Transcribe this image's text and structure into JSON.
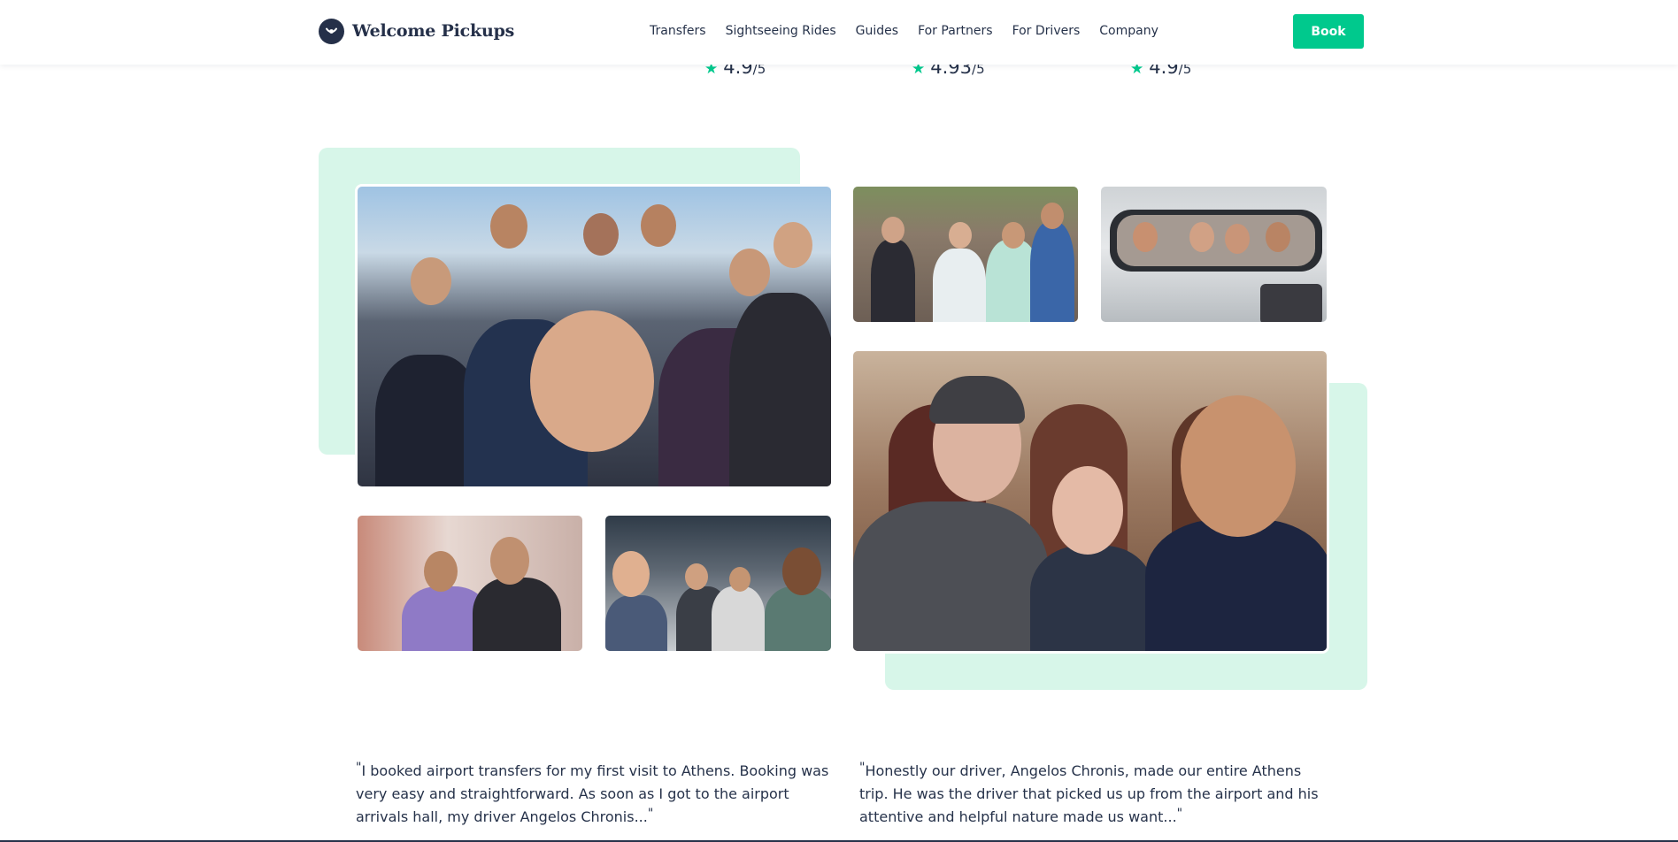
{
  "brand": {
    "name": "Welcome Pickups",
    "logo_icon": "welcome-pickups-logo-icon",
    "accent_color": "#00c98d",
    "dark_color": "#253049",
    "decor_color": "#d7f6e9"
  },
  "nav": {
    "items": [
      {
        "label": "Transfers"
      },
      {
        "label": "Sightseeing Rides"
      },
      {
        "label": "Guides"
      },
      {
        "label": "For Partners"
      },
      {
        "label": "For Drivers"
      },
      {
        "label": "Company"
      }
    ],
    "book_label": "Book"
  },
  "ratings": [
    {
      "value": "4.9",
      "suffix": "/5",
      "icon": "star-icon"
    },
    {
      "value": "4.93",
      "suffix": "/5",
      "icon": "star-icon"
    },
    {
      "value": "4.9",
      "suffix": "/5",
      "icon": "star-icon"
    }
  ],
  "testimonials": [
    {
      "open_mark": "\"",
      "text": "I booked airport transfers for my first visit to Athens. Booking was very easy and straightforward. As soon as I got to the airport arrivals hall, my driver Angelos Chronis...",
      "close_mark": "\""
    },
    {
      "open_mark": "\"",
      "text": "Honestly our driver, Angelos Chronis, made our entire Athens trip. He was the driver that picked us up from the airport and his attentive and helpful nature made us want...",
      "close_mark": "\""
    }
  ]
}
